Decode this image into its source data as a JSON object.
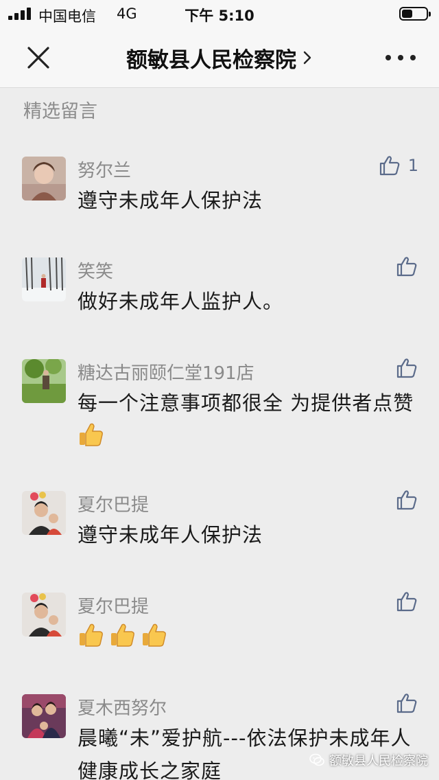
{
  "status_bar": {
    "carrier": "中国电信",
    "network": "4G",
    "time": "下午 5:10"
  },
  "nav": {
    "title": "额敏县人民检察院",
    "close_icon": "close-icon",
    "more_icon": "more-dots-icon"
  },
  "section_title": "精选留言",
  "comments": [
    {
      "name": "努尔兰",
      "text": "遵守未成年人保护法",
      "likes": "1"
    },
    {
      "name": "笑笑",
      "text": "做好未成年人监护人。",
      "likes": ""
    },
    {
      "name": "糖达古丽颐仁堂191店",
      "text": "每一个注意事项都很全  为提供者点赞",
      "emoji": "thumbs-up",
      "likes": ""
    },
    {
      "name": "夏尔巴提",
      "text": "遵守未成年人保护法",
      "likes": ""
    },
    {
      "name": "夏尔巴提",
      "text": "",
      "emoji_count": 3,
      "emoji": "thumbs-up",
      "likes": ""
    },
    {
      "name": "夏木西努尔",
      "text": "晨曦“未”爱护航---依法保护未成年人健康成长之家庭",
      "likes": ""
    }
  ],
  "watermark": "额敏县人民检察院",
  "colors": {
    "background": "#ededed",
    "bar": "#f7f7f7",
    "name": "#8a8a8a",
    "like_icon": "#5b6b8a"
  }
}
